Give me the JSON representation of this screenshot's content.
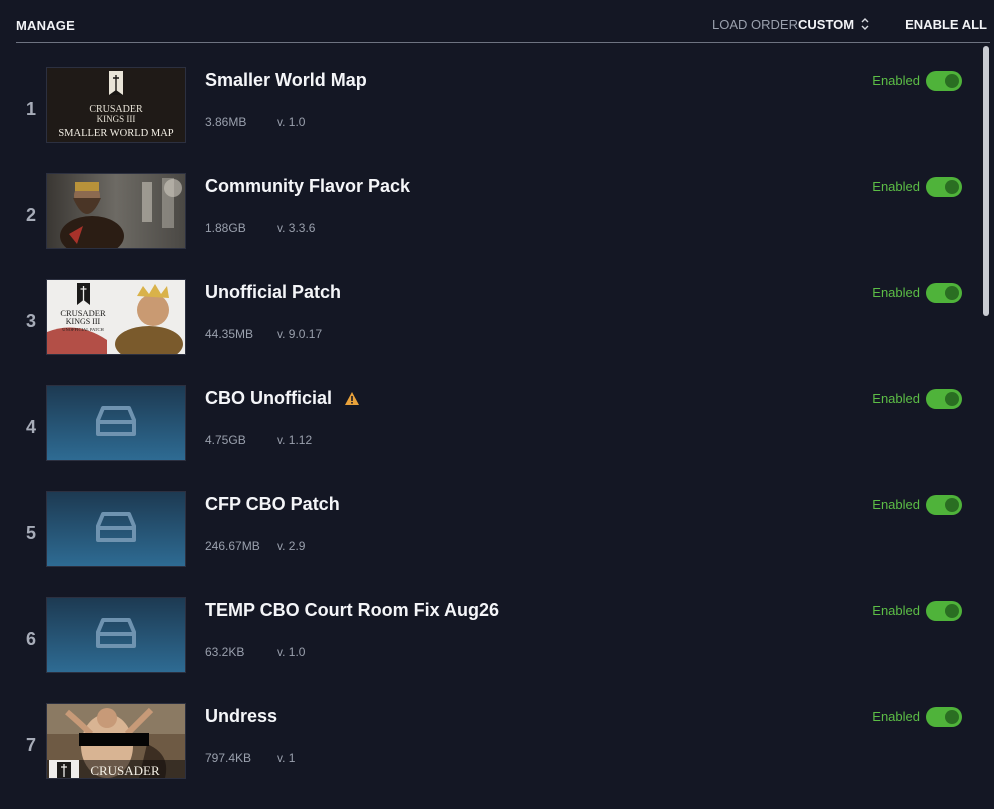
{
  "header": {
    "manage_label": "MANAGE",
    "load_order_label": "LOAD ORDER",
    "load_order_value": "CUSTOM",
    "enable_all_label": "ENABLE ALL"
  },
  "thumbnail_text": {
    "crusader": "CRUSADER",
    "kings": "KINGS III",
    "smaller_world_map": "SMALLER WORLD MAP",
    "unofficial_patch": "UNOFFICIAL PATCH"
  },
  "mods": [
    {
      "index": "1",
      "title": "Smaller World Map",
      "size": "3.86MB",
      "version": "v. 1.0",
      "status": "Enabled",
      "thumb": "smaller-world-map-thumbnail",
      "warning": false
    },
    {
      "index": "2",
      "title": "Community Flavor Pack",
      "size": "1.88GB",
      "version": "v. 3.3.6",
      "status": "Enabled",
      "thumb": "community-flavor-pack-thumbnail",
      "warning": false
    },
    {
      "index": "3",
      "title": "Unofficial Patch",
      "size": "44.35MB",
      "version": "v. 9.0.17",
      "status": "Enabled",
      "thumb": "unofficial-patch-thumbnail",
      "warning": false
    },
    {
      "index": "4",
      "title": "CBO Unofficial",
      "size": "4.75GB",
      "version": "v. 1.12",
      "status": "Enabled",
      "thumb": "placeholder-drive-thumbnail",
      "warning": true
    },
    {
      "index": "5",
      "title": "CFP CBO Patch",
      "size": "246.67MB",
      "version": "v. 2.9",
      "status": "Enabled",
      "thumb": "placeholder-drive-thumbnail",
      "warning": false
    },
    {
      "index": "6",
      "title": "TEMP CBO Court Room Fix Aug26",
      "size": "63.2KB",
      "version": "v. 1.0",
      "status": "Enabled",
      "thumb": "placeholder-drive-thumbnail",
      "warning": false
    },
    {
      "index": "7",
      "title": "Undress",
      "size": "797.4KB",
      "version": "v. 1",
      "status": "Enabled",
      "thumb": "undress-painting-thumbnail",
      "warning": false
    }
  ],
  "colors": {
    "background": "#141724",
    "enabled_green": "#5cbd46",
    "toggle_on": "#4fb33a",
    "warning": "#e9a23b",
    "placeholder_blue": "#2b5d80"
  },
  "icons": [
    "sort-updown-icon",
    "warning-icon",
    "drive-icon",
    "crown-sword-icon",
    "toggle-switch-icon"
  ]
}
